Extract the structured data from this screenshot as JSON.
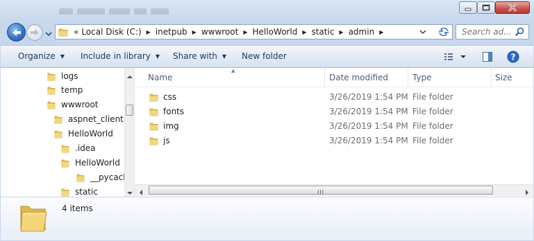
{
  "window": {
    "background_title_glyphs": "",
    "controls": {
      "minimize": "minimize",
      "maximize": "maximize",
      "close": "close"
    }
  },
  "nav": {
    "back_icon": "back-arrow",
    "forward_icon": "forward-arrow",
    "recent_icon": "chevron-down",
    "overflow": "«",
    "breadcrumbs": [
      "Local Disk (C:)",
      "inetpub",
      "wwwroot",
      "HelloWorld",
      "static",
      "admin"
    ],
    "refresh_icon": "refresh",
    "search_placeholder": "Search ad..."
  },
  "command_bar": {
    "organize": "Organize",
    "include_in_library": "Include in library",
    "share_with": "Share with",
    "new_folder": "New folder",
    "view_icon": "view-options",
    "preview_icon": "preview-pane",
    "help_icon": "help"
  },
  "tree": {
    "items": [
      {
        "label": "logs",
        "indent": 0
      },
      {
        "label": "temp",
        "indent": 0
      },
      {
        "label": "wwwroot",
        "indent": 0
      },
      {
        "label": "aspnet_client",
        "indent": 1
      },
      {
        "label": "HelloWorld",
        "indent": 1
      },
      {
        "label": ".idea",
        "indent": 2
      },
      {
        "label": "HelloWorld",
        "indent": 2
      },
      {
        "label": "__pycache_",
        "indent": 3
      },
      {
        "label": "static",
        "indent": 2
      }
    ]
  },
  "list": {
    "columns": {
      "name": "Name",
      "date_modified": "Date modified",
      "type": "Type",
      "size": "Size"
    },
    "rows": [
      {
        "name": "css",
        "date_modified": "3/26/2019 1:54 PM",
        "type": "File folder"
      },
      {
        "name": "fonts",
        "date_modified": "3/26/2019 1:54 PM",
        "type": "File folder"
      },
      {
        "name": "img",
        "date_modified": "3/26/2019 1:54 PM",
        "type": "File folder"
      },
      {
        "name": "js",
        "date_modified": "3/26/2019 1:54 PM",
        "type": "File folder"
      }
    ],
    "scroll_grip": "III"
  },
  "details": {
    "item_count": "4 items"
  },
  "colors": {
    "folder": "#e8c25a",
    "folder_dark": "#c99a2e",
    "header_text": "#4c607a",
    "cmd_text": "#1e395b",
    "help_blue": "#2a6bc8"
  }
}
